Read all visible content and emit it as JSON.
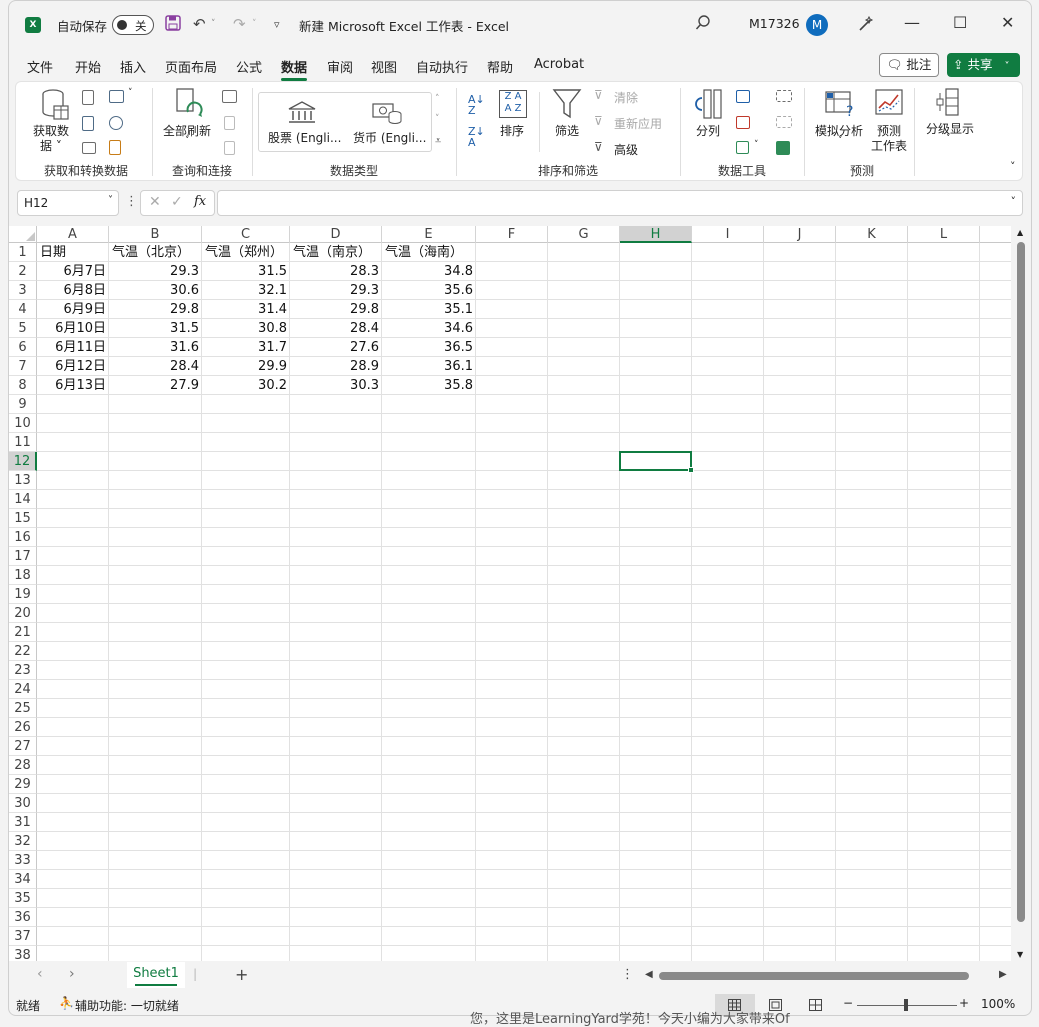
{
  "titlebar": {
    "app_logo": "X",
    "autosave_label": "自动保存",
    "autosave_state": "关",
    "doc_title": "新建 Microsoft Excel 工作表  -  Excel",
    "user_name": "M17326",
    "avatar_initial": "M"
  },
  "menu": {
    "items": [
      "文件",
      "开始",
      "插入",
      "页面布局",
      "公式",
      "数据",
      "审阅",
      "视图",
      "自动执行",
      "帮助",
      "Acrobat"
    ],
    "active": "数据",
    "comment_button": "批注",
    "share_button": "共享"
  },
  "ribbon": {
    "get_data_label": "获取数",
    "get_data_label2": "据 ˅",
    "group_get_transform": "获取和转换数据",
    "refresh_all_label": "全部刷新",
    "group_query": "查询和连接",
    "stocks_label": "股票 (Engli...",
    "currency_label": "货币 (Engli...",
    "group_data_types": "数据类型",
    "sort_label": "排序",
    "filter_label": "筛选",
    "clear_label": "清除",
    "reapply_label": "重新应用",
    "advanced_label": "高级",
    "group_sort_filter": "排序和筛选",
    "text_to_columns_label": "分列",
    "group_data_tools": "数据工具",
    "what_if_label": "模拟分析",
    "forecast_sheet_label": "预测",
    "forecast_sheet_label2": "工作表",
    "group_forecast": "预测",
    "outline_label": "分级显示"
  },
  "formula_bar": {
    "name_box": "H12",
    "fx": "fx",
    "formula": ""
  },
  "sheet": {
    "columns": [
      "A",
      "B",
      "C",
      "D",
      "E",
      "F",
      "G",
      "H",
      "I",
      "J",
      "K",
      "L"
    ],
    "selected_column": "H",
    "selected_row": "12",
    "row_count": 38,
    "headers": [
      "日期",
      "气温（北京）",
      "气温（郑州）",
      "气温（南京）",
      "气温（海南）"
    ],
    "rows": [
      [
        "6月7日",
        "29.3",
        "31.5",
        "28.3",
        "34.8"
      ],
      [
        "6月8日",
        "30.6",
        "32.1",
        "29.3",
        "35.6"
      ],
      [
        "6月9日",
        "29.8",
        "31.4",
        "29.8",
        "35.1"
      ],
      [
        "6月10日",
        "31.5",
        "30.8",
        "28.4",
        "34.6"
      ],
      [
        "6月11日",
        "31.6",
        "31.7",
        "27.6",
        "36.5"
      ],
      [
        "6月12日",
        "28.4",
        "29.9",
        "28.9",
        "36.1"
      ],
      [
        "6月13日",
        "27.9",
        "30.2",
        "30.3",
        "35.8"
      ]
    ]
  },
  "tabs": {
    "sheet_name": "Sheet1",
    "add_label": "+"
  },
  "status": {
    "ready": "就绪",
    "accessibility": "辅助功能: 一切就绪",
    "zoom": "100%"
  },
  "background_text": "您，这里是LearningYard学苑！今天小编为大家带来Of"
}
